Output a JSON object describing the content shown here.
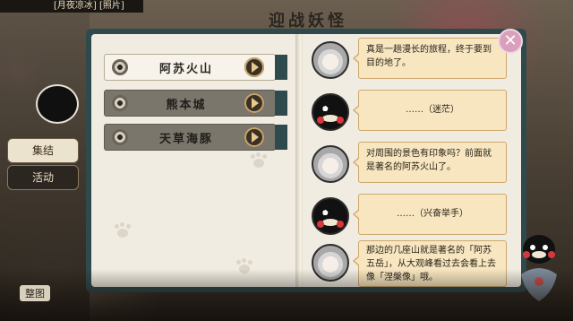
{
  "header": {
    "breadcrumb": "[月夜凉冰] [照片]",
    "title_bg": "迎战妖怪"
  },
  "side_menu": {
    "gather_label": "集结",
    "activity_label": "活动"
  },
  "bottom": {
    "label": "整图"
  },
  "locations": [
    {
      "name": "阿苏火山",
      "state": "active"
    },
    {
      "name": "熊本城",
      "state": "inactive"
    },
    {
      "name": "天草海豚",
      "state": "inactive"
    }
  ],
  "dialogue": [
    {
      "speaker": "silver-haired-character",
      "text": "真是一趟漫长的旅程，终于要到目的地了。"
    },
    {
      "speaker": "kumamon",
      "text": "……（迷茫）"
    },
    {
      "speaker": "silver-haired-character",
      "text": "对周围的景色有印象吗？前面就是著名的阿苏火山了。"
    },
    {
      "speaker": "kumamon",
      "text": "……（兴奋举手）"
    },
    {
      "speaker": "silver-haired-character",
      "text": "那边的几座山就是著名的「阿苏五岳」，从大观峰看过去会看上去像「涅槃像」哦。"
    }
  ],
  "colors": {
    "book_cover": "#2f4a4c",
    "page": "#f1ece1",
    "bubble": "#f7e6c0",
    "close_button": "#d8a0ba"
  },
  "icons": {
    "close": "✕"
  }
}
